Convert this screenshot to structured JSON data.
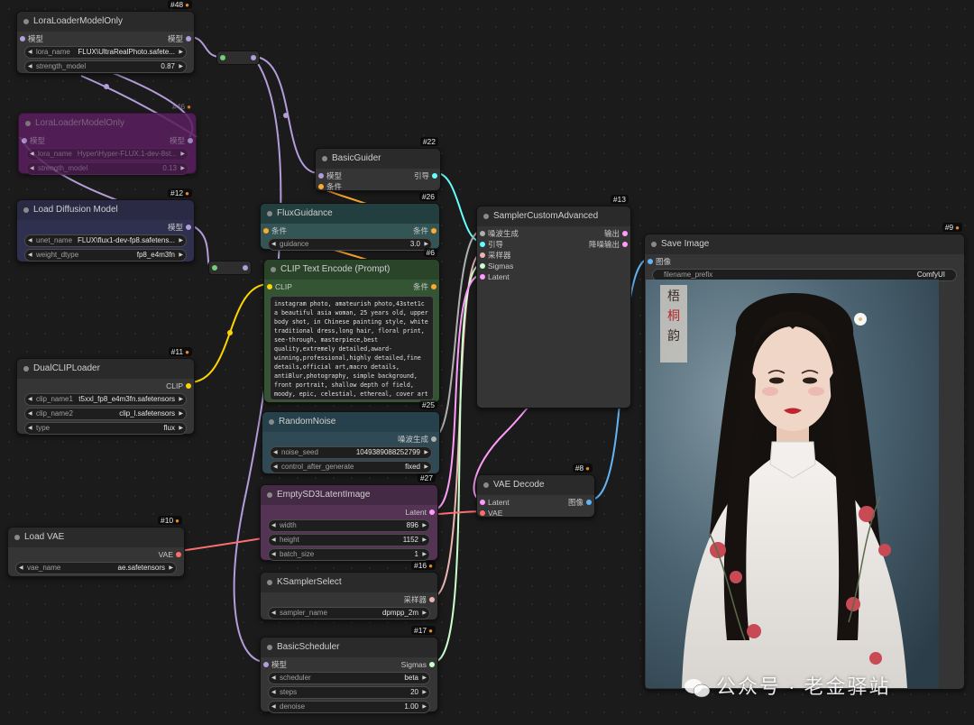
{
  "nodes": {
    "lora1": {
      "id": "#48",
      "title": "LoraLoaderModelOnly",
      "input": "模型",
      "output": "模型",
      "lora_name_label": "lora_name",
      "lora_name_value": "FLUX\\UltraRealPhoto.safete...",
      "strength_label": "strength_model",
      "strength_value": "0.87"
    },
    "lora2": {
      "id": "#46",
      "title": "LoraLoaderModelOnly",
      "input": "模型",
      "output": "模型",
      "lora_name_label": "lora_name",
      "lora_name_value": "Hyper\\Hyper-FLUX.1-dev-8st...",
      "strength_label": "strength_model",
      "strength_value": "0.13"
    },
    "diffusion": {
      "id": "#12",
      "title": "Load Diffusion Model",
      "output": "模型",
      "unet_label": "unet_name",
      "unet_value": "FLUX\\flux1-dev-fp8.safetens...",
      "dtype_label": "weight_dtype",
      "dtype_value": "fp8_e4m3fn"
    },
    "dualclip": {
      "id": "#11",
      "title": "DualCLIPLoader",
      "output": "CLIP",
      "clip1_label": "clip_name1",
      "clip1_value": "t5xxl_fp8_e4m3fn.safetensors",
      "clip2_label": "clip_name2",
      "clip2_value": "clip_l.safetensors",
      "type_label": "type",
      "type_value": "flux"
    },
    "loadvae": {
      "id": "#10",
      "title": "Load VAE",
      "output": "VAE",
      "vae_label": "vae_name",
      "vae_value": "ae.safetensors"
    },
    "guider": {
      "id": "#22",
      "title": "BasicGuider",
      "in1": "模型",
      "in2": "条件",
      "output": "引导"
    },
    "fluxguidance": {
      "id": "#26",
      "title": "FluxGuidance",
      "input": "条件",
      "output": "条件",
      "guidance_label": "guidance",
      "guidance_value": "3.0"
    },
    "clipencode": {
      "id": "#6",
      "title": "CLIP Text Encode (Prompt)",
      "input": "CLIP",
      "output": "条件",
      "prompt": "instagram photo, amateurish photo,43stet1c a beautiful asia woman, 25 years old, upper body shot, in Chinese painting style, white traditional dress,long hair,  floral print, see-through, masterpiece,best quality,extremely detailed,award-winning,professional,highly detailed,fine details,official art,macro details, antiBlur,photography, simple background, front portrait, shallow depth of field, moody, epic,  celestial, ethereal, cover art"
    },
    "randomnoise": {
      "id": "#25",
      "title": "RandomNoise",
      "output": "噪波生成",
      "seed_label": "noise_seed",
      "seed_value": "1049389088252799",
      "control_label": "control_after_generate",
      "control_value": "fixed"
    },
    "latent": {
      "id": "#27",
      "title": "EmptySD3LatentImage",
      "output": "Latent",
      "width_label": "width",
      "width_value": "896",
      "height_label": "height",
      "height_value": "1152",
      "batch_label": "batch_size",
      "batch_value": "1"
    },
    "ksampler": {
      "id": "#16",
      "title": "KSamplerSelect",
      "output": "采样器",
      "sampler_label": "sampler_name",
      "sampler_value": "dpmpp_2m"
    },
    "scheduler": {
      "id": "#17",
      "title": "BasicScheduler",
      "input": "模型",
      "output": "Sigmas",
      "scheduler_label": "scheduler",
      "scheduler_value": "beta",
      "steps_label": "steps",
      "steps_value": "20",
      "denoise_label": "denoise",
      "denoise_value": "1.00"
    },
    "sampler": {
      "id": "#13",
      "title": "SamplerCustomAdvanced",
      "in1": "噪波生成",
      "in2": "引导",
      "in3": "采样器",
      "in4": "Sigmas",
      "in5": "Latent",
      "out1": "输出",
      "out2": "降噪输出"
    },
    "vaedecode": {
      "id": "#8",
      "title": "VAE Decode",
      "in1": "Latent",
      "in2": "VAE",
      "output": "图像"
    },
    "saveimage": {
      "id": "#9",
      "title": "Save Image",
      "input": "图像",
      "prefix_label": "filename_prefix",
      "prefix_value": "ComfyUI"
    }
  },
  "image_seal": {
    "line1": "梧",
    "line2": "桐",
    "line3": "韵"
  },
  "watermark": "公众号 · 老金驿站",
  "colors": {
    "model": "#b39ddb",
    "clip": "#ffd500",
    "conditioning": "#ffa931",
    "vae": "#ff6e6e",
    "latent": "#ff9cf9",
    "noise": "#b0b0b0",
    "guider": "#66ffff",
    "sampler": "#ecb4b4",
    "sigmas": "#cdffcd",
    "image": "#64b5f6"
  }
}
